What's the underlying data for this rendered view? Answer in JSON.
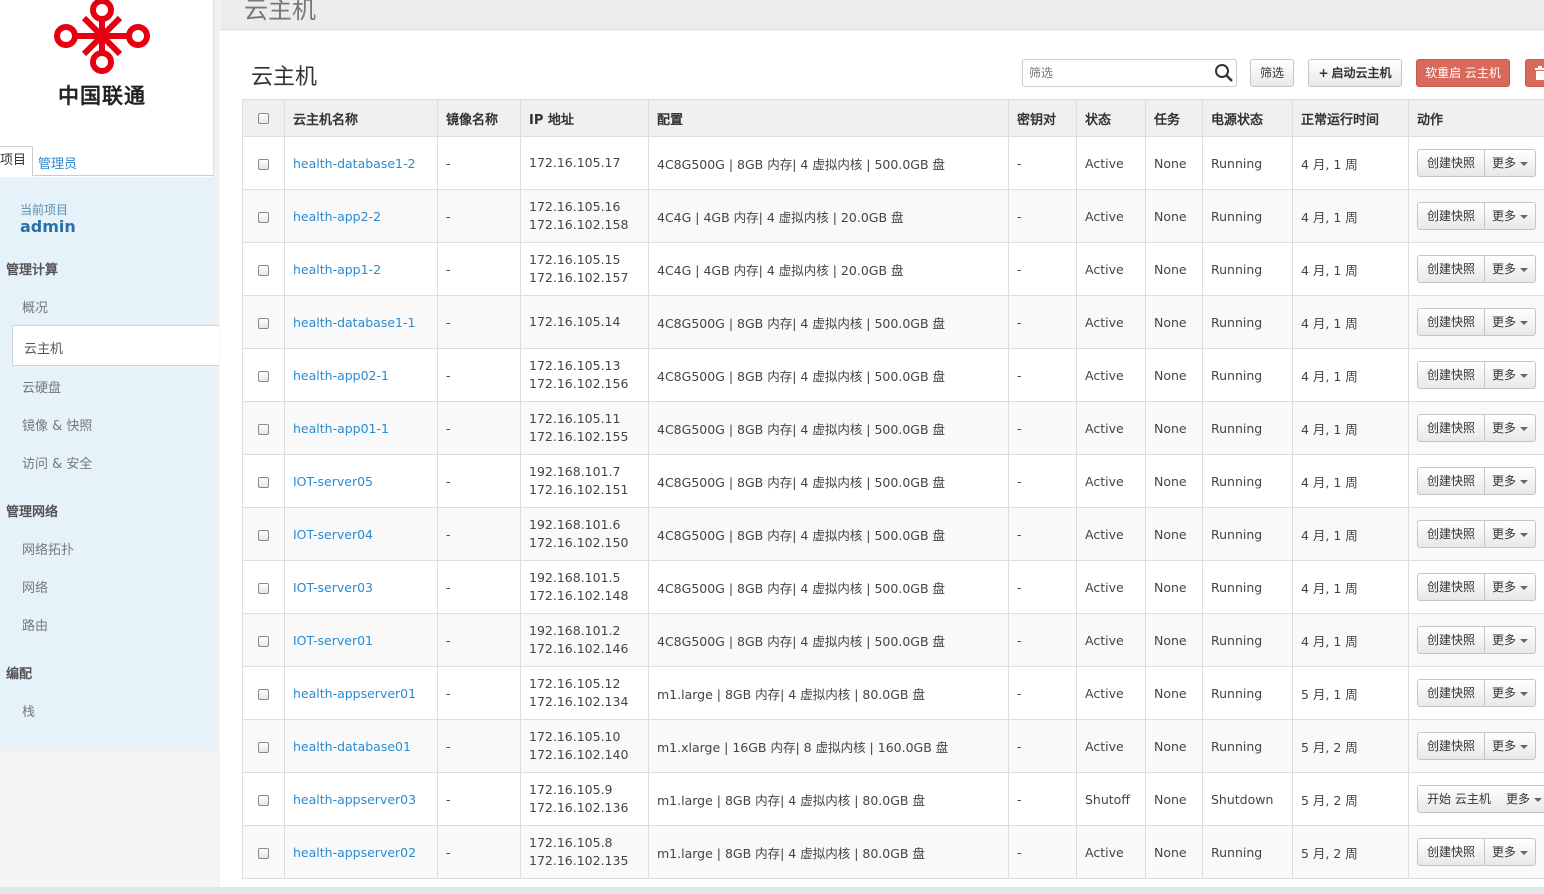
{
  "logo": {
    "brand_text": "中国联通"
  },
  "sidebar": {
    "tabs": [
      "项目",
      "管理员"
    ],
    "current_project_label": "当前项目",
    "current_project_value": "admin",
    "sections": [
      {
        "heading": "管理计算",
        "items": [
          "概况",
          "云主机",
          "云硬盘",
          "镜像 & 快照",
          "访问 & 安全"
        ]
      },
      {
        "heading": "管理网络",
        "items": [
          "网络拓扑",
          "网络",
          "路由"
        ]
      },
      {
        "heading": "编配",
        "items": [
          "栈"
        ]
      }
    ],
    "active_item": "云主机"
  },
  "topbar": {
    "title": "云主机"
  },
  "header": {
    "title": "云主机",
    "filter_placeholder": "筛选",
    "filter_button": "筛选",
    "launch_button": "启动云主机",
    "reboot_button": "软重启 云主机",
    "delete_icon": "trash-icon",
    "search_icon": "search-icon"
  },
  "colors": {
    "link": "#2a8bd0",
    "danger": "#d9695b",
    "nav_bg": "#e6f2fa"
  },
  "table": {
    "columns": [
      "云主机名称",
      "镜像名称",
      "IP 地址",
      "配置",
      "密钥对",
      "状态",
      "任务",
      "电源状态",
      "正常运行时间",
      "动作"
    ],
    "more_label": "更多",
    "rows": [
      {
        "name": "health-database1-2",
        "image": "-",
        "ips": [
          "172.16.105.17"
        ],
        "config": "4C8G500G | 8GB 内存| 4 虚拟内核 | 500.0GB 盘",
        "key": "-",
        "status": "Active",
        "task": "None",
        "power": "Running",
        "uptime": "4 月, 1 周",
        "action": "创建快照"
      },
      {
        "name": "health-app2-2",
        "image": "-",
        "ips": [
          "172.16.105.16",
          "172.16.102.158"
        ],
        "config": "4C4G | 4GB 内存| 4 虚拟内核 | 20.0GB 盘",
        "key": "-",
        "status": "Active",
        "task": "None",
        "power": "Running",
        "uptime": "4 月, 1 周",
        "action": "创建快照"
      },
      {
        "name": "health-app1-2",
        "image": "-",
        "ips": [
          "172.16.105.15",
          "172.16.102.157"
        ],
        "config": "4C4G | 4GB 内存| 4 虚拟内核 | 20.0GB 盘",
        "key": "-",
        "status": "Active",
        "task": "None",
        "power": "Running",
        "uptime": "4 月, 1 周",
        "action": "创建快照"
      },
      {
        "name": "health-database1-1",
        "image": "-",
        "ips": [
          "172.16.105.14"
        ],
        "config": "4C8G500G | 8GB 内存| 4 虚拟内核 | 500.0GB 盘",
        "key": "-",
        "status": "Active",
        "task": "None",
        "power": "Running",
        "uptime": "4 月, 1 周",
        "action": "创建快照"
      },
      {
        "name": "health-app02-1",
        "image": "-",
        "ips": [
          "172.16.105.13",
          "172.16.102.156"
        ],
        "config": "4C8G500G | 8GB 内存| 4 虚拟内核 | 500.0GB 盘",
        "key": "-",
        "status": "Active",
        "task": "None",
        "power": "Running",
        "uptime": "4 月, 1 周",
        "action": "创建快照"
      },
      {
        "name": "health-app01-1",
        "image": "-",
        "ips": [
          "172.16.105.11",
          "172.16.102.155"
        ],
        "config": "4C8G500G | 8GB 内存| 4 虚拟内核 | 500.0GB 盘",
        "key": "-",
        "status": "Active",
        "task": "None",
        "power": "Running",
        "uptime": "4 月, 1 周",
        "action": "创建快照"
      },
      {
        "name": "IOT-server05",
        "image": "-",
        "ips": [
          "192.168.101.7",
          "172.16.102.151"
        ],
        "config": "4C8G500G | 8GB 内存| 4 虚拟内核 | 500.0GB 盘",
        "key": "-",
        "status": "Active",
        "task": "None",
        "power": "Running",
        "uptime": "4 月, 1 周",
        "action": "创建快照"
      },
      {
        "name": "IOT-server04",
        "image": "-",
        "ips": [
          "192.168.101.6",
          "172.16.102.150"
        ],
        "config": "4C8G500G | 8GB 内存| 4 虚拟内核 | 500.0GB 盘",
        "key": "-",
        "status": "Active",
        "task": "None",
        "power": "Running",
        "uptime": "4 月, 1 周",
        "action": "创建快照"
      },
      {
        "name": "IOT-server03",
        "image": "-",
        "ips": [
          "192.168.101.5",
          "172.16.102.148"
        ],
        "config": "4C8G500G | 8GB 内存| 4 虚拟内核 | 500.0GB 盘",
        "key": "-",
        "status": "Active",
        "task": "None",
        "power": "Running",
        "uptime": "4 月, 1 周",
        "action": "创建快照"
      },
      {
        "name": "IOT-server01",
        "image": "-",
        "ips": [
          "192.168.101.2",
          "172.16.102.146"
        ],
        "config": "4C8G500G | 8GB 内存| 4 虚拟内核 | 500.0GB 盘",
        "key": "-",
        "status": "Active",
        "task": "None",
        "power": "Running",
        "uptime": "4 月, 1 周",
        "action": "创建快照"
      },
      {
        "name": "health-appserver01",
        "image": "-",
        "ips": [
          "172.16.105.12",
          "172.16.102.134"
        ],
        "config": "m1.large | 8GB 内存| 4 虚拟内核 | 80.0GB 盘",
        "key": "-",
        "status": "Active",
        "task": "None",
        "power": "Running",
        "uptime": "5 月, 1 周",
        "action": "创建快照"
      },
      {
        "name": "health-database01",
        "image": "-",
        "ips": [
          "172.16.105.10",
          "172.16.102.140"
        ],
        "config": "m1.xlarge | 16GB 内存| 8 虚拟内核 | 160.0GB 盘",
        "key": "-",
        "status": "Active",
        "task": "None",
        "power": "Running",
        "uptime": "5 月, 2 周",
        "action": "创建快照"
      },
      {
        "name": "health-appserver03",
        "image": "-",
        "ips": [
          "172.16.105.9",
          "172.16.102.136"
        ],
        "config": "m1.large | 8GB 内存| 4 虚拟内核 | 80.0GB 盘",
        "key": "-",
        "status": "Shutoff",
        "task": "None",
        "power": "Shutdown",
        "uptime": "5 月, 2 周",
        "action": "开始 云主机"
      },
      {
        "name": "health-appserver02",
        "image": "-",
        "ips": [
          "172.16.105.8",
          "172.16.102.135"
        ],
        "config": "m1.large | 8GB 内存| 4 虚拟内核 | 80.0GB 盘",
        "key": "-",
        "status": "Active",
        "task": "None",
        "power": "Running",
        "uptime": "5 月, 2 周",
        "action": "创建快照"
      }
    ]
  }
}
